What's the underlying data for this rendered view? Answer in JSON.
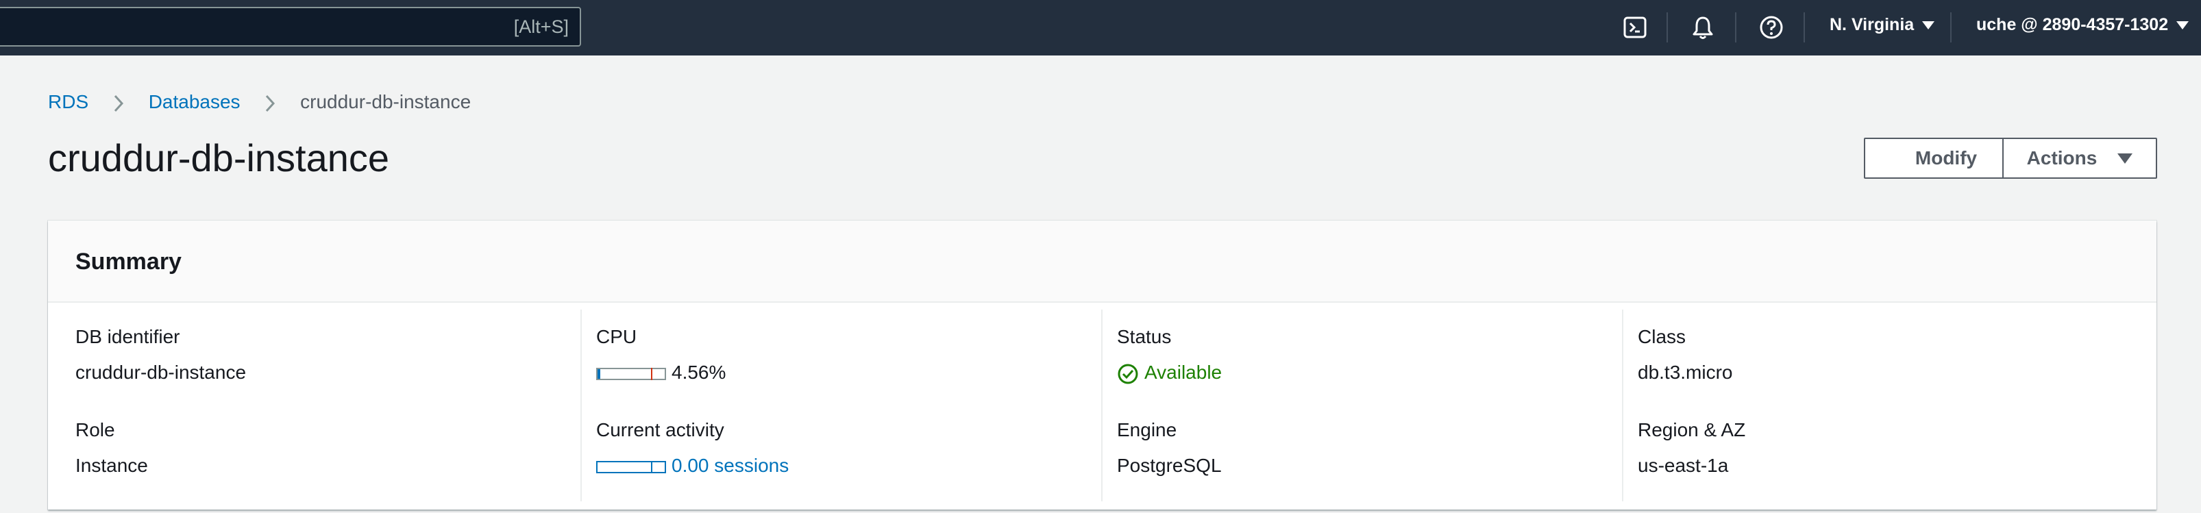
{
  "topnav": {
    "search_hint": "[Alt+S]",
    "region": "N. Virginia",
    "account": "uche @ 2890-4357-1302"
  },
  "breadcrumb": {
    "items": [
      "RDS",
      "Databases",
      "cruddur-db-instance"
    ]
  },
  "page": {
    "title": "cruddur-db-instance",
    "modify_label": "Modify",
    "actions_label": "Actions"
  },
  "summary": {
    "title": "Summary",
    "db_identifier_label": "DB identifier",
    "db_identifier": "cruddur-db-instance",
    "role_label": "Role",
    "role": "Instance",
    "cpu_label": "CPU",
    "cpu_value": "4.56%",
    "cpu_fraction": 0.0456,
    "activity_label": "Current activity",
    "activity_value": "0.00 sessions",
    "status_label": "Status",
    "status": "Available",
    "engine_label": "Engine",
    "engine": "PostgreSQL",
    "class_label": "Class",
    "class": "db.t3.micro",
    "region_label": "Region & AZ",
    "region": "us-east-1a"
  },
  "colors": {
    "nav_bg": "#232f3e",
    "link": "#0073bb",
    "success": "#1d8102"
  }
}
